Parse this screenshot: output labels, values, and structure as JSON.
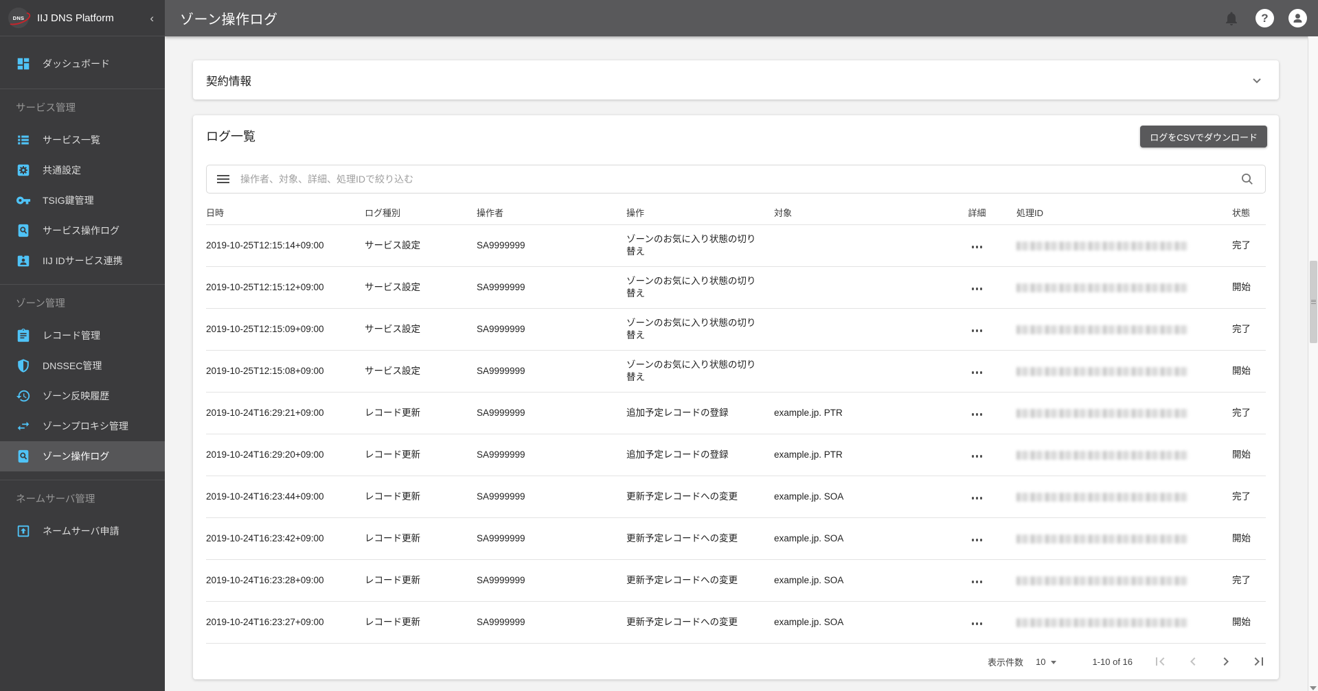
{
  "app": {
    "brand": "IIJ DNS Platform",
    "page_title": "ゾーン操作ログ",
    "accent_color": "#4FC3F7",
    "appbar_color": "#59595B",
    "sidebar_color": "#3B3B3D"
  },
  "topbar_icons": [
    "bell-icon",
    "help-icon",
    "account-icon"
  ],
  "sidebar": {
    "collapse_chevron": "‹",
    "sections": [
      {
        "label": "",
        "items": [
          {
            "icon": "dashboard",
            "label": "ダッシュボード"
          }
        ]
      },
      {
        "label": "サービス管理",
        "items": [
          {
            "icon": "list",
            "label": "サービス一覧"
          },
          {
            "icon": "settings-box",
            "label": "共通設定"
          },
          {
            "icon": "key",
            "label": "TSIG鍵管理"
          },
          {
            "icon": "doc-search",
            "label": "サービス操作ログ"
          },
          {
            "icon": "id-badge",
            "label": "IIJ IDサービス連携"
          }
        ]
      },
      {
        "label": "ゾーン管理",
        "items": [
          {
            "icon": "clipboard",
            "label": "レコード管理"
          },
          {
            "icon": "shield",
            "label": "DNSSEC管理"
          },
          {
            "icon": "history",
            "label": "ゾーン反映履歴"
          },
          {
            "icon": "swap",
            "label": "ゾーンプロキシ管理"
          },
          {
            "icon": "doc-search",
            "label": "ゾーン操作ログ",
            "selected": true
          }
        ]
      },
      {
        "label": "ネームサーバ管理",
        "items": [
          {
            "icon": "upload-box",
            "label": "ネームサーバ申請"
          }
        ]
      }
    ]
  },
  "contract_panel": {
    "title": "契約情報"
  },
  "log_panel": {
    "title": "ログ一覧",
    "csv_button": "ログをCSVでダウンロード",
    "search_placeholder": "操作者、対象、詳細、処理IDで絞り込む",
    "detail_icon": "more-horiz-icon"
  },
  "table": {
    "columns": [
      "日時",
      "ログ種別",
      "操作者",
      "操作",
      "対象",
      "詳細",
      "処理ID",
      "状態"
    ],
    "rows": [
      {
        "datetime": "2019-10-25T12:15:14+09:00",
        "type": "サービス設定",
        "operator": "SA9999999",
        "operation": "ゾーンのお気に入り状態の切り替え",
        "target": "",
        "processing_id_masked": true,
        "status": "完了"
      },
      {
        "datetime": "2019-10-25T12:15:12+09:00",
        "type": "サービス設定",
        "operator": "SA9999999",
        "operation": "ゾーンのお気に入り状態の切り替え",
        "target": "",
        "processing_id_masked": true,
        "status": "開始"
      },
      {
        "datetime": "2019-10-25T12:15:09+09:00",
        "type": "サービス設定",
        "operator": "SA9999999",
        "operation": "ゾーンのお気に入り状態の切り替え",
        "target": "",
        "processing_id_masked": true,
        "status": "完了"
      },
      {
        "datetime": "2019-10-25T12:15:08+09:00",
        "type": "サービス設定",
        "operator": "SA9999999",
        "operation": "ゾーンのお気に入り状態の切り替え",
        "target": "",
        "processing_id_masked": true,
        "status": "開始"
      },
      {
        "datetime": "2019-10-24T16:29:21+09:00",
        "type": "レコード更新",
        "operator": "SA9999999",
        "operation": "追加予定レコードの登録",
        "target": "example.jp. PTR",
        "processing_id_masked": true,
        "status": "完了"
      },
      {
        "datetime": "2019-10-24T16:29:20+09:00",
        "type": "レコード更新",
        "operator": "SA9999999",
        "operation": "追加予定レコードの登録",
        "target": "example.jp. PTR",
        "processing_id_masked": true,
        "status": "開始"
      },
      {
        "datetime": "2019-10-24T16:23:44+09:00",
        "type": "レコード更新",
        "operator": "SA9999999",
        "operation": "更新予定レコードへの変更",
        "target": "example.jp. SOA",
        "processing_id_masked": true,
        "status": "完了"
      },
      {
        "datetime": "2019-10-24T16:23:42+09:00",
        "type": "レコード更新",
        "operator": "SA9999999",
        "operation": "更新予定レコードへの変更",
        "target": "example.jp. SOA",
        "processing_id_masked": true,
        "status": "開始"
      },
      {
        "datetime": "2019-10-24T16:23:28+09:00",
        "type": "レコード更新",
        "operator": "SA9999999",
        "operation": "更新予定レコードへの変更",
        "target": "example.jp. SOA",
        "processing_id_masked": true,
        "status": "完了"
      },
      {
        "datetime": "2019-10-24T16:23:27+09:00",
        "type": "レコード更新",
        "operator": "SA9999999",
        "operation": "更新予定レコードへの変更",
        "target": "example.jp. SOA",
        "processing_id_masked": true,
        "status": "開始"
      }
    ]
  },
  "pagination": {
    "rows_per_page_label": "表示件数",
    "page_size": "10",
    "range_label": "1-10 of 16"
  }
}
